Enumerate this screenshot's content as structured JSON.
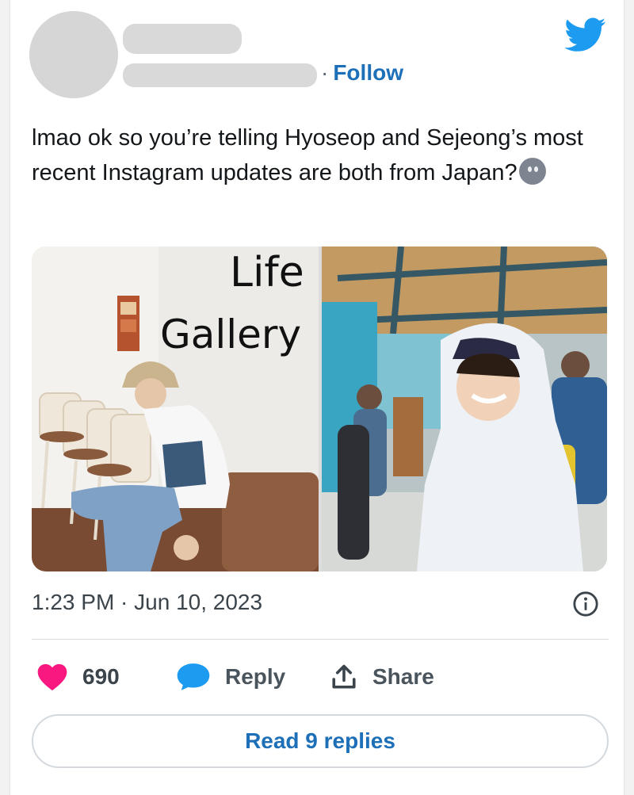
{
  "author": {
    "follow_label": "Follow",
    "separator": "·"
  },
  "icons": {
    "brand": "twitter-bird-icon",
    "info": "info-icon",
    "like": "heart-icon",
    "reply": "speech-bubble-icon",
    "share": "share-icon"
  },
  "tweet": {
    "text": "lmao ok so you’re telling Hyoseop and Sejeong’s most recent Instagram updates are both from Japan?",
    "timestamp": "1:23 PM · Jun 10, 2023"
  },
  "media": {
    "left_photo_sign": [
      "Life",
      "Gallery"
    ]
  },
  "actions": {
    "like_count": "690",
    "reply_label": "Reply",
    "share_label": "Share"
  },
  "footer": {
    "read_replies_label": "Read 9 replies"
  },
  "colors": {
    "brand": "#1d9bf0",
    "link": "#1d6fb8",
    "like": "#f91880",
    "reply": "#1d9bf0"
  }
}
